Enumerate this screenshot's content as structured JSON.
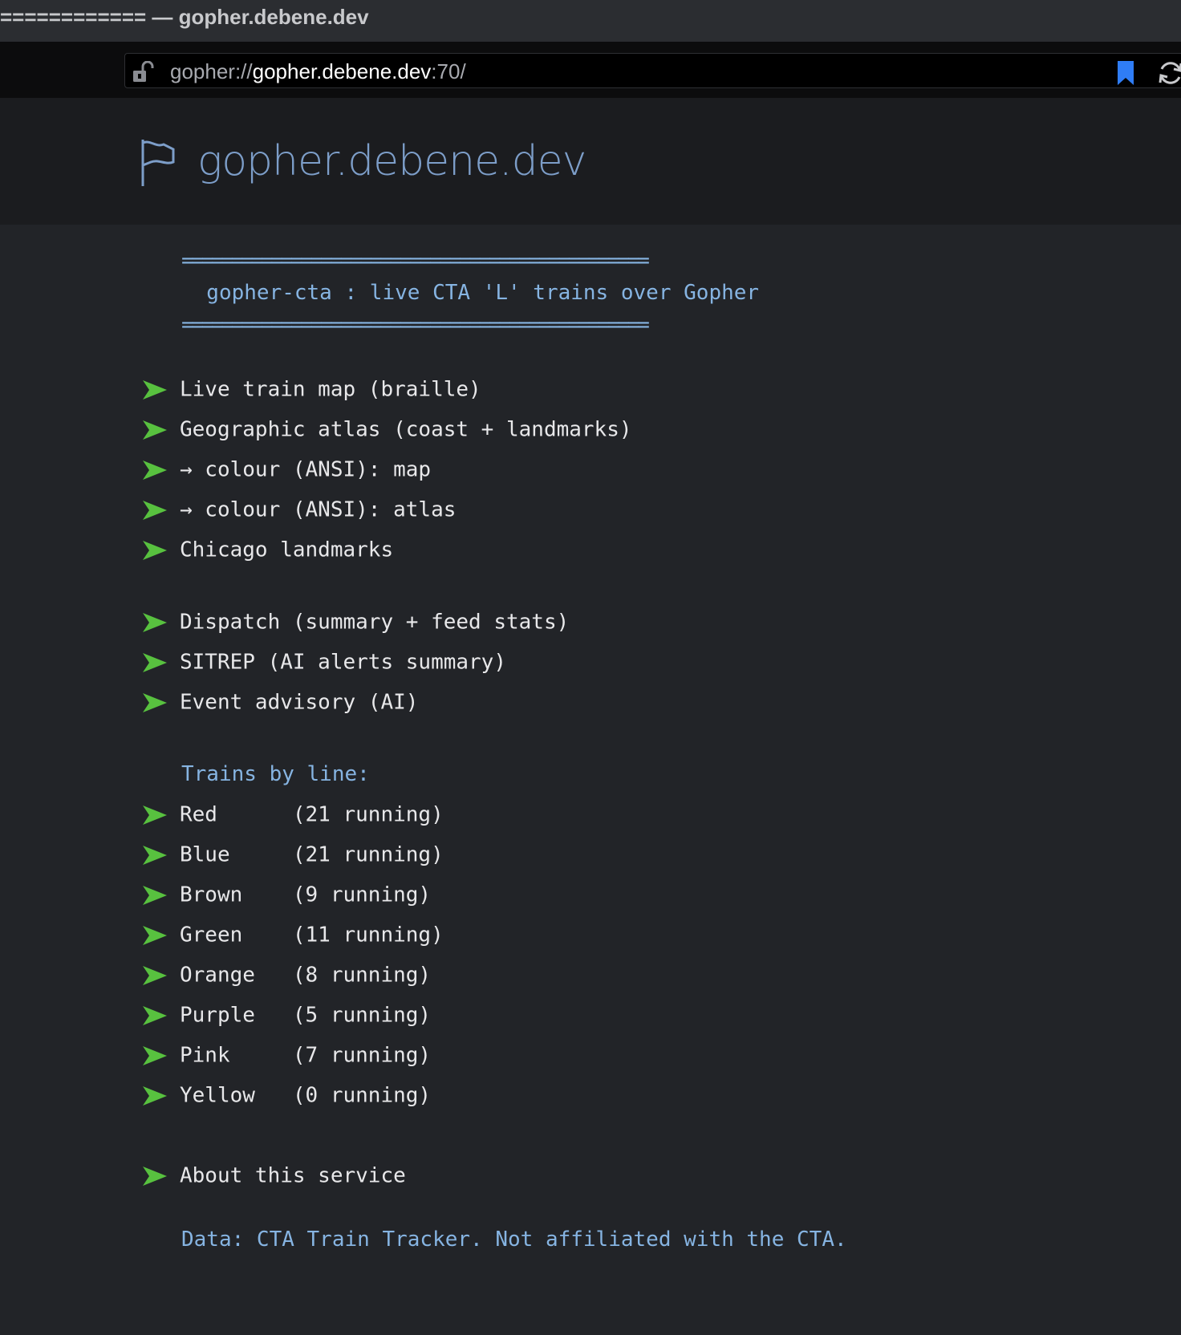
{
  "window": {
    "title": "============ — gopher.debene.dev"
  },
  "urlbar": {
    "scheme": "gopher://",
    "host": "gopher.debene.dev",
    "rest": ":70/"
  },
  "banner": {
    "title": "gopher.debene.dev"
  },
  "content": {
    "rule_top": "===============================================",
    "heading": "  gopher-cta : live CTA 'L' trains over Gopher",
    "rule_bottom": "===============================================",
    "links_main": [
      {
        "label": "Live train map (braille)"
      },
      {
        "label": "Geographic atlas (coast + landmarks)"
      },
      {
        "label": "→ colour (ANSI): map"
      },
      {
        "label": "→ colour (ANSI): atlas"
      },
      {
        "label": "Chicago landmarks"
      }
    ],
    "links_ai": [
      {
        "label": "Dispatch (summary + feed stats)"
      },
      {
        "label": "SITREP (AI alerts summary)"
      },
      {
        "label": "Event advisory (AI)"
      }
    ],
    "lines_heading": "Trains by line:",
    "lines": [
      {
        "label": "Red      (21 running)"
      },
      {
        "label": "Blue     (21 running)"
      },
      {
        "label": "Brown    (9 running)"
      },
      {
        "label": "Green    (11 running)"
      },
      {
        "label": "Orange   (8 running)"
      },
      {
        "label": "Purple   (5 running)"
      },
      {
        "label": "Pink     (7 running)"
      },
      {
        "label": "Yellow   (0 running)"
      }
    ],
    "about": {
      "label": "About this service"
    },
    "footer": "Data: CTA Train Tracker. Not affiliated with the CTA."
  },
  "colors": {
    "arrow": "#58c13f",
    "info_text": "#86b4e2",
    "link_text": "#e8e8ea",
    "bookmark": "#2f7df6"
  },
  "icons": {
    "lock": "insecure-lock-icon",
    "bookmark": "bookmark-icon",
    "reload": "reload-icon",
    "flag": "flag-icon",
    "menu_item": "arrow-icon"
  }
}
